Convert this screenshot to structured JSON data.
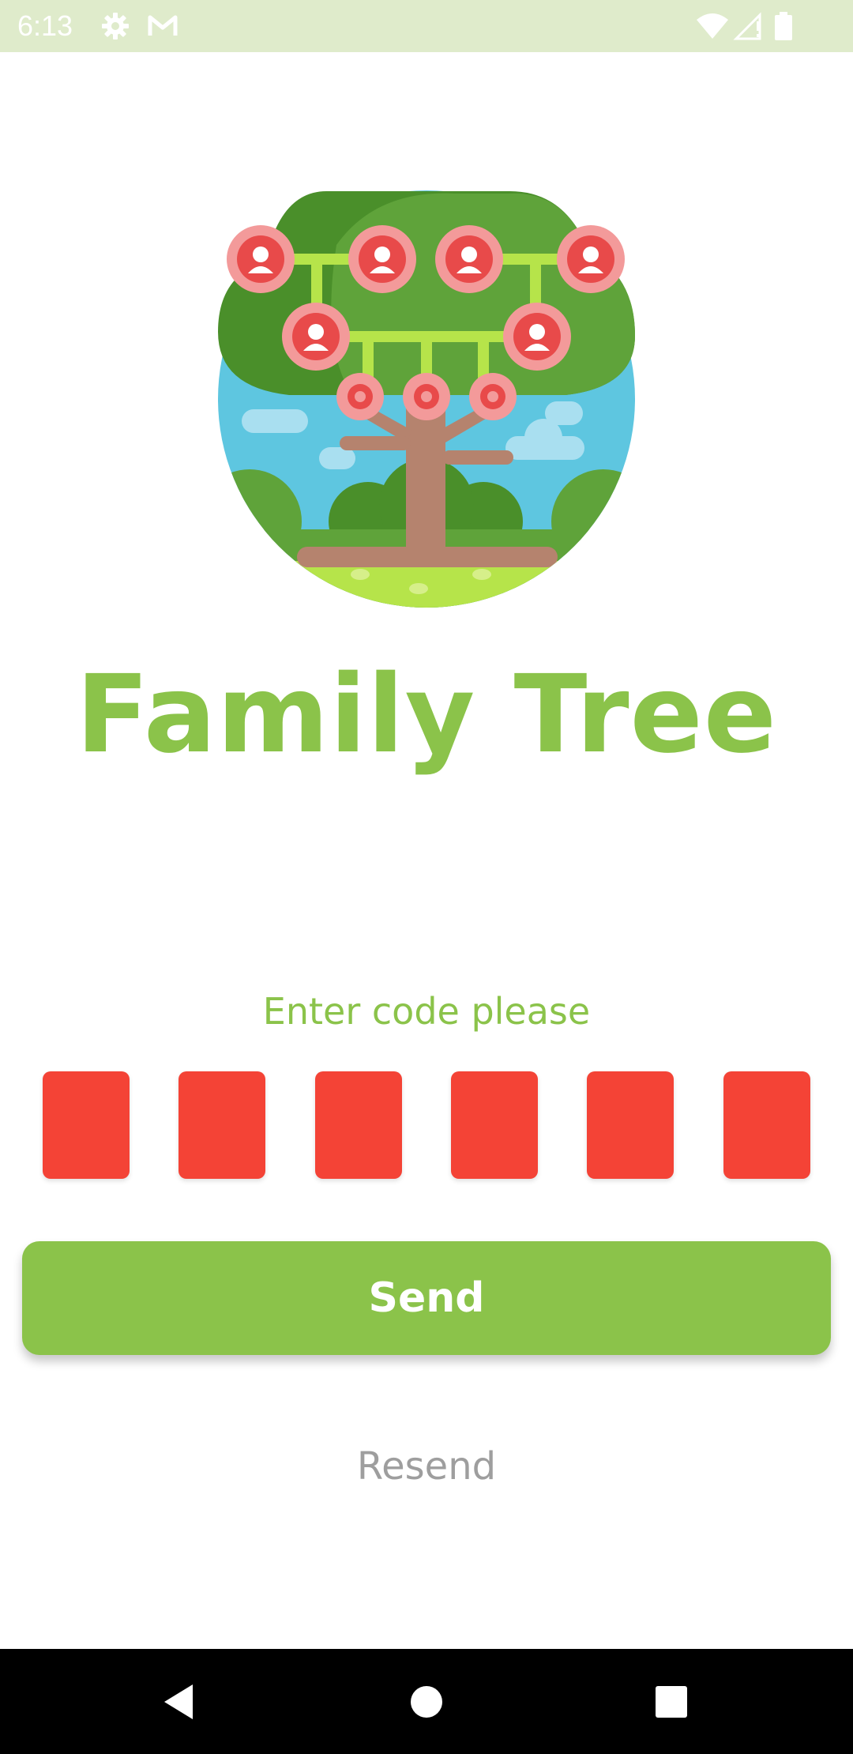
{
  "status_bar": {
    "time": "6:13",
    "left_icons": [
      "settings-icon",
      "gmail-icon"
    ],
    "right_icons": [
      "wifi-icon",
      "signal-icon",
      "battery-icon"
    ]
  },
  "logo": {
    "icon": "family-tree-icon"
  },
  "app_title": "Family Tree",
  "verification": {
    "prompt": "Enter code please",
    "code_digits": [
      "",
      "",
      "",
      "",
      "",
      ""
    ],
    "box_color": "#f44336"
  },
  "send_button": {
    "label": "Send"
  },
  "resend_link": {
    "label": "Resend"
  },
  "nav_bar": {
    "buttons": [
      "back-icon",
      "home-icon",
      "recents-icon"
    ]
  },
  "colors": {
    "accent": "#8bc34a",
    "status_bar_bg": "#dfebcb",
    "code_box": "#f44336",
    "resend_text": "#9e9e9e"
  }
}
